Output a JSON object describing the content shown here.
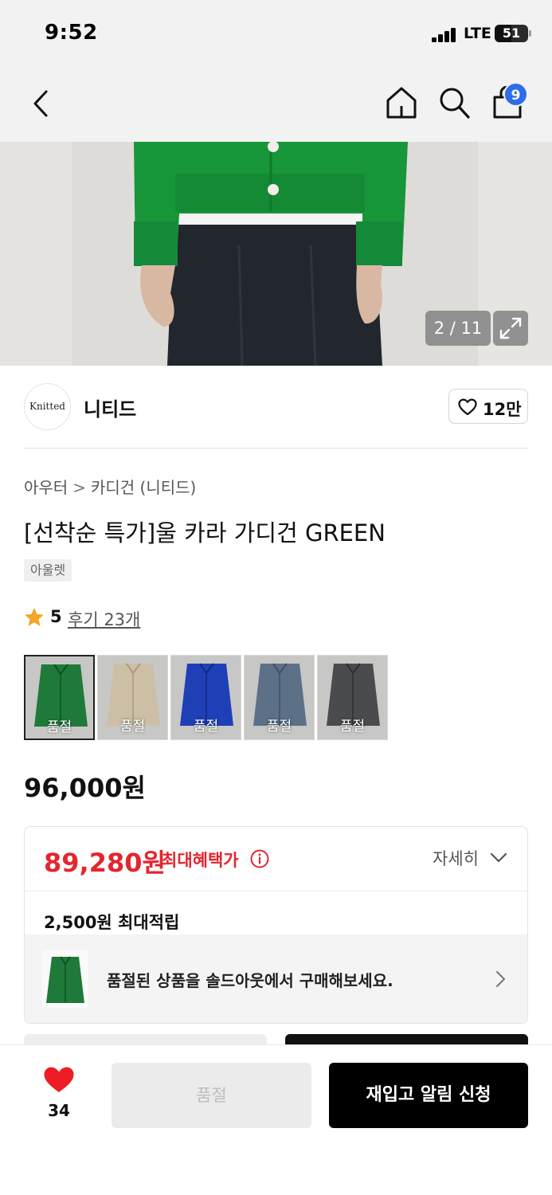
{
  "status_bar": {
    "time": "9:52",
    "network": "LTE",
    "battery": "51",
    "battery_level": 0.51
  },
  "nav": {
    "cart_count": "9"
  },
  "gallery": {
    "counter": "2 / 11"
  },
  "brand": {
    "logo_text": "Knitted",
    "name": "니티드",
    "like_count": "12만"
  },
  "breadcrumb": {
    "parent": "아우터",
    "separator": ">",
    "current": "카디건 (니티드)"
  },
  "product": {
    "title": "[선착순 특가]울 카라 가디건 GREEN",
    "tag": "아울렛",
    "rating": "5",
    "reviews": "후기 23개",
    "original_price": "96,000원"
  },
  "options": [
    {
      "label": "품절",
      "color": "#1f7a3a"
    },
    {
      "label": "품절",
      "color": "#cdbfa6"
    },
    {
      "label": "품절",
      "color": "#1f3fb7"
    },
    {
      "label": "품절",
      "color": "#5c7088"
    },
    {
      "label": "품절",
      "color": "#4a4b4d"
    }
  ],
  "benefit": {
    "sale_price": "89,280원",
    "sale_label": "최대혜택가",
    "details": "자세히",
    "points": "2,500원 최대적립",
    "soldout_message": "품절된 상품을 솔드아웃에서 구매해보세요."
  },
  "bottom_bar": {
    "wish_count": "34",
    "soldout_button": "품절",
    "restock_button": "재입고 알림 신청"
  },
  "colors": {
    "accent_red": "#e3262f",
    "badge_blue": "#2f6bea",
    "star": "#f5a623"
  }
}
